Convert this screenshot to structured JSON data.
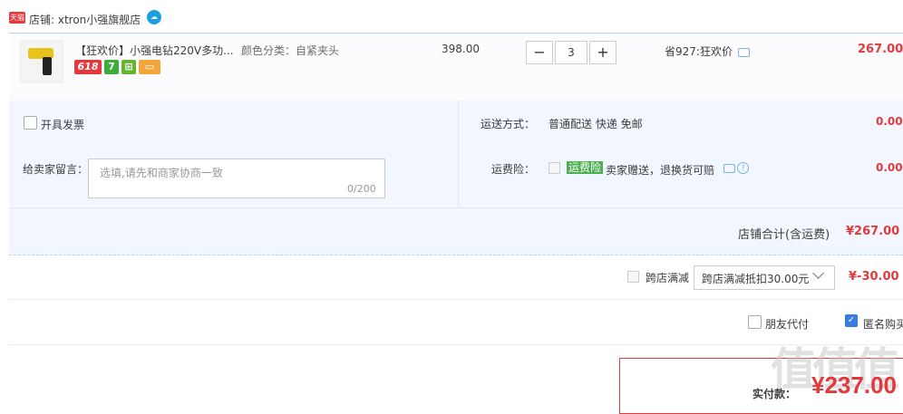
{
  "shop": {
    "badge": "天猫",
    "name": "店铺: xtron小强旗舰店",
    "ww_icon": "wangwang-icon"
  },
  "item": {
    "title": "【狂欢价】小强电钻220V多功...",
    "sku": "颜色分类：自紧夹头",
    "badges": [
      "618",
      "7",
      "",
      ""
    ],
    "price": "398.00",
    "qty": {
      "minus": "−",
      "value": "3",
      "plus": "+"
    },
    "promo": "省927:狂欢价",
    "subtotal": "267.00"
  },
  "options": {
    "invoice_label": "开具发票",
    "message_label": "给卖家留言：",
    "message_placeholder": "选填,请先和商家协商一致",
    "message_count": "0/200",
    "shipping_label": "运送方式：",
    "shipping_value": "普通配送 快递 免邮",
    "shipping_fee": "0.00",
    "insurance_label": "运费险：",
    "insurance_tag": "运费险",
    "insurance_text": "卖家赠送，退换货可赔",
    "insurance_q": "?",
    "insurance_fee": "0.00",
    "shop_total_label": "店铺合计(含运费)",
    "shop_total": "¥267.00"
  },
  "cross_store": {
    "label": "跨店满减",
    "select_value": "跨店满减抵扣30.00元",
    "value": "¥-30.00"
  },
  "friend_pay_label": "朋友代付",
  "anon_buy_label": "匿名购买",
  "anon_check": "✓",
  "payment": {
    "label": "实付款：",
    "value": "¥237.00"
  },
  "watermark": "值值值",
  "colors": {
    "accent_red": "#e4393c",
    "panel_bg": "#f2f7ff",
    "border_blue": "#b2d1ff"
  }
}
